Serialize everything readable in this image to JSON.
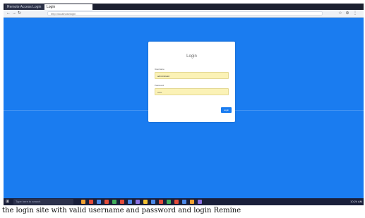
{
  "browser": {
    "tabs": [
      {
        "label": "Remote Access Login"
      },
      {
        "label": "Login"
      }
    ],
    "address": "http://localhost/login",
    "nav": {
      "back": "←",
      "forward": "→",
      "refresh": "↻"
    },
    "toolbar_icons": [
      "star-icon",
      "extensions-icon",
      "menu-icon"
    ]
  },
  "login_card": {
    "title": "Login",
    "username_label": "Username",
    "username_value": "administrator",
    "password_label": "Password",
    "password_value": "••••••",
    "submit_label": "Login"
  },
  "taskbar": {
    "search_placeholder": "Type here to search",
    "clock": "10:24 AM",
    "app_colors": [
      "#f0a030",
      "#e24b3a",
      "#4a88e8",
      "#e24b3a",
      "#3fae5a",
      "#e24b3a",
      "#4a88e8",
      "#8a6fe0",
      "#f0c030",
      "#4a88e8",
      "#e24b3a",
      "#3fae5a",
      "#e24b3a",
      "#4a88e8",
      "#f0a030",
      "#8a6fe0"
    ]
  },
  "caption": "the login site with valid username and password and login Remine"
}
